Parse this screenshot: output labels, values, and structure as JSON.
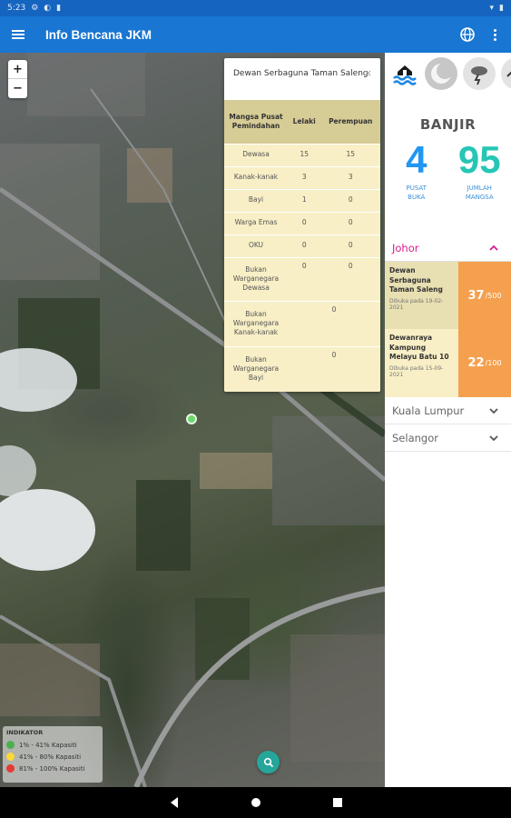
{
  "status_bar": {
    "time": "5:23"
  },
  "app_bar": {
    "title": "Info Bencana JKM"
  },
  "map": {
    "zoom_in": "+",
    "zoom_out": "−",
    "popup": {
      "title": "Dewan Serbaguna Taman Saleng",
      "close": "×",
      "headers": [
        "Mangsa Pusat Pemindahan",
        "Lelaki",
        "Perempuan"
      ],
      "rows": [
        {
          "label": "Dewasa",
          "lelaki": "15",
          "perempuan": "15"
        },
        {
          "label": "Kanak-kanak",
          "lelaki": "3",
          "perempuan": "3"
        },
        {
          "label": "Bayi",
          "lelaki": "1",
          "perempuan": "0"
        },
        {
          "label": "Warga Emas",
          "lelaki": "0",
          "perempuan": "0"
        },
        {
          "label": "OKU",
          "lelaki": "0",
          "perempuan": "0"
        },
        {
          "label": "Bukan Warganegara Dewasa",
          "lelaki": "0",
          "perempuan": "0"
        },
        {
          "label": "Bukan Warganegara Kanak-kanak",
          "combined": "0"
        },
        {
          "label": "Bukan Warganegara Bayi",
          "combined": "0"
        }
      ]
    },
    "legend": {
      "title": "INDIKATOR",
      "items": [
        {
          "label": "1% - 41% Kapasiti",
          "color": "#4caf50"
        },
        {
          "label": "41% - 80% Kapasiti",
          "color": "#fdd835"
        },
        {
          "label": "81% - 100% Kapasiti",
          "color": "#e53935"
        }
      ]
    }
  },
  "side_panel": {
    "category": "BANJIR",
    "stats": [
      {
        "value": "4",
        "label_line1": "PUSAT",
        "label_line2": "BUKA"
      },
      {
        "value": "95",
        "label_line1": "JUMLAH",
        "label_line2": "MANGSA"
      }
    ],
    "states": [
      {
        "name": "Johor",
        "expanded": true,
        "centers": [
          {
            "name": "Dewan Serbaguna Taman Saleng",
            "opened": "Dibuka pada 19-02-2021",
            "current": "37",
            "capacity": "/500"
          },
          {
            "name": "Dewanraya Kampung Melayu Batu 10",
            "opened": "Dibuka pada 15-09-2021",
            "current": "22",
            "capacity": "/100"
          }
        ]
      },
      {
        "name": "Kuala Lumpur",
        "expanded": false
      },
      {
        "name": "Selangor",
        "expanded": false
      }
    ]
  }
}
